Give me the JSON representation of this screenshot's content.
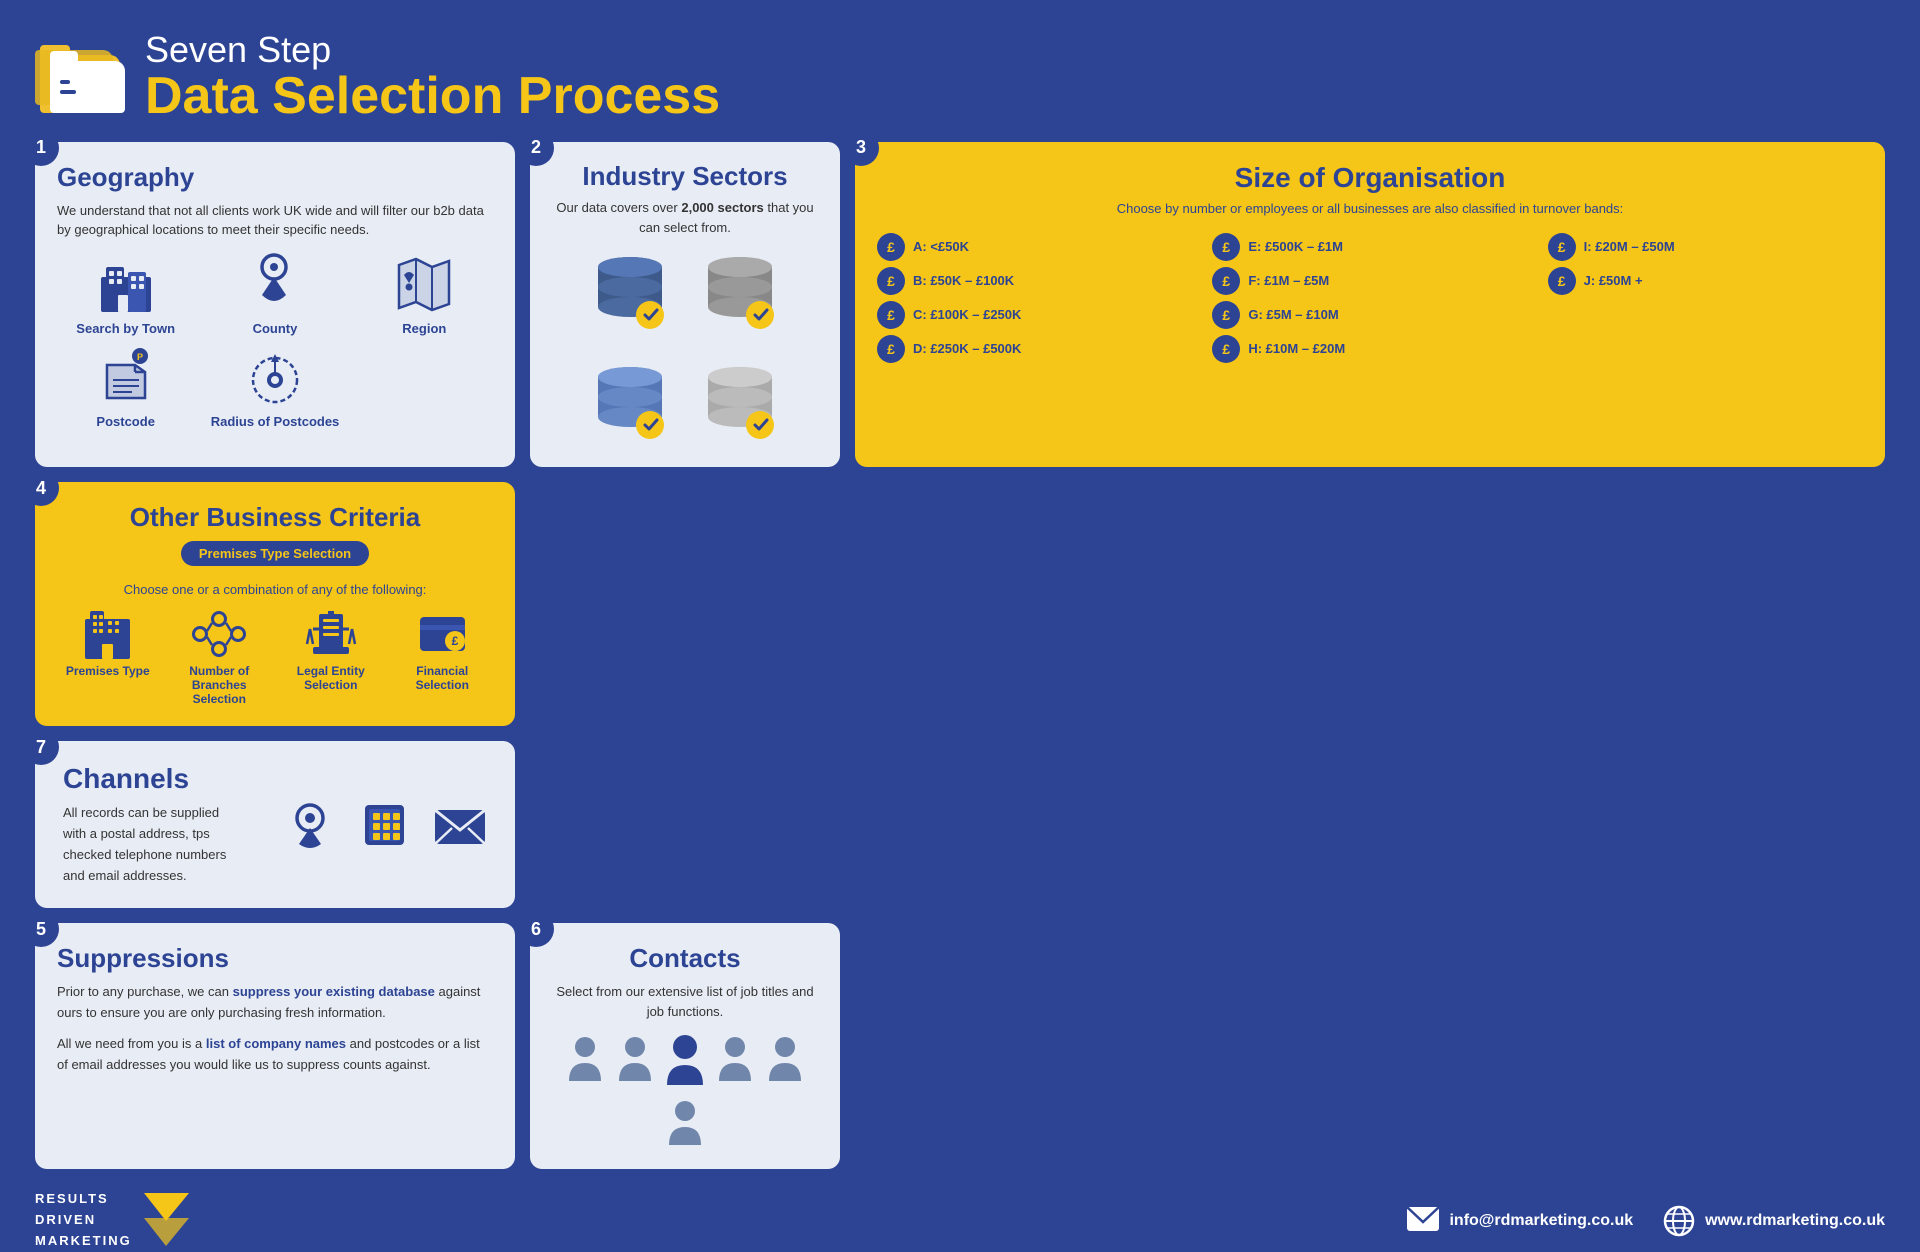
{
  "header": {
    "subtitle": "Seven Step",
    "title": "Data Selection Process"
  },
  "steps": {
    "step1": {
      "number": "1",
      "title": "Geography",
      "description": "We understand that not all clients work UK wide and will filter our b2b data by geographical locations to meet their specific needs.",
      "items": [
        {
          "label": "Search by Town"
        },
        {
          "label": "County"
        },
        {
          "label": "Region"
        },
        {
          "label": "Postcode"
        },
        {
          "label": "Radius of Postcodes"
        }
      ]
    },
    "step2": {
      "number": "2",
      "title": "Industry Sectors",
      "description": "Our data covers over 2,000 sectors that you can select from.",
      "highlight": "2,000"
    },
    "step3": {
      "number": "3",
      "title": "Size of Organisation",
      "description": "Choose by number or employees or all businesses are also classified in turnover bands:",
      "bands": [
        {
          "label": "A: <£50K"
        },
        {
          "label": "B: £50K – £100K"
        },
        {
          "label": "C: £100K – £250K"
        },
        {
          "label": "D: £250K – £500K"
        },
        {
          "label": "E: £500K – £1M"
        },
        {
          "label": "F: £1M – £5M"
        },
        {
          "label": "G: £5M – £10M"
        },
        {
          "label": "H: £10M – £20M"
        },
        {
          "label": "I: £20M – £50M"
        },
        {
          "label": "J: £50M +"
        }
      ]
    },
    "step4": {
      "number": "4",
      "title": "Other Business Criteria",
      "badge": "Premises Type Selection",
      "description": "Choose one or a combination of any of the following:",
      "items": [
        {
          "label": "Premises Type"
        },
        {
          "label": "Number of Branches Selection"
        },
        {
          "label": "Legal Entity Selection"
        },
        {
          "label": "Financial Selection"
        }
      ]
    },
    "step5": {
      "number": "5",
      "title": "Suppressions",
      "para1": "Prior to any purchase, we can suppress your existing database against ours to ensure you are only purchasing fresh information.",
      "para2_pre": "All we need from you is a ",
      "para2_link": "list of company names",
      "para2_post": " and postcodes or a list of email addresses you would like us to suppress counts against.",
      "highlight1": "suppress your existing database"
    },
    "step6": {
      "number": "6",
      "title": "Contacts",
      "description": "Select from our extensive list of job titles and job functions."
    },
    "step7": {
      "number": "7",
      "title": "Channels",
      "description": "All records can be supplied with a postal address, tps checked telephone numbers and email addresses."
    }
  },
  "footer": {
    "logo_lines": [
      "RESULTS",
      "DRIVEN",
      "MARKETING"
    ],
    "email": "info@rdmarketing.co.uk",
    "website": "www.rdmarketing.co.uk"
  }
}
